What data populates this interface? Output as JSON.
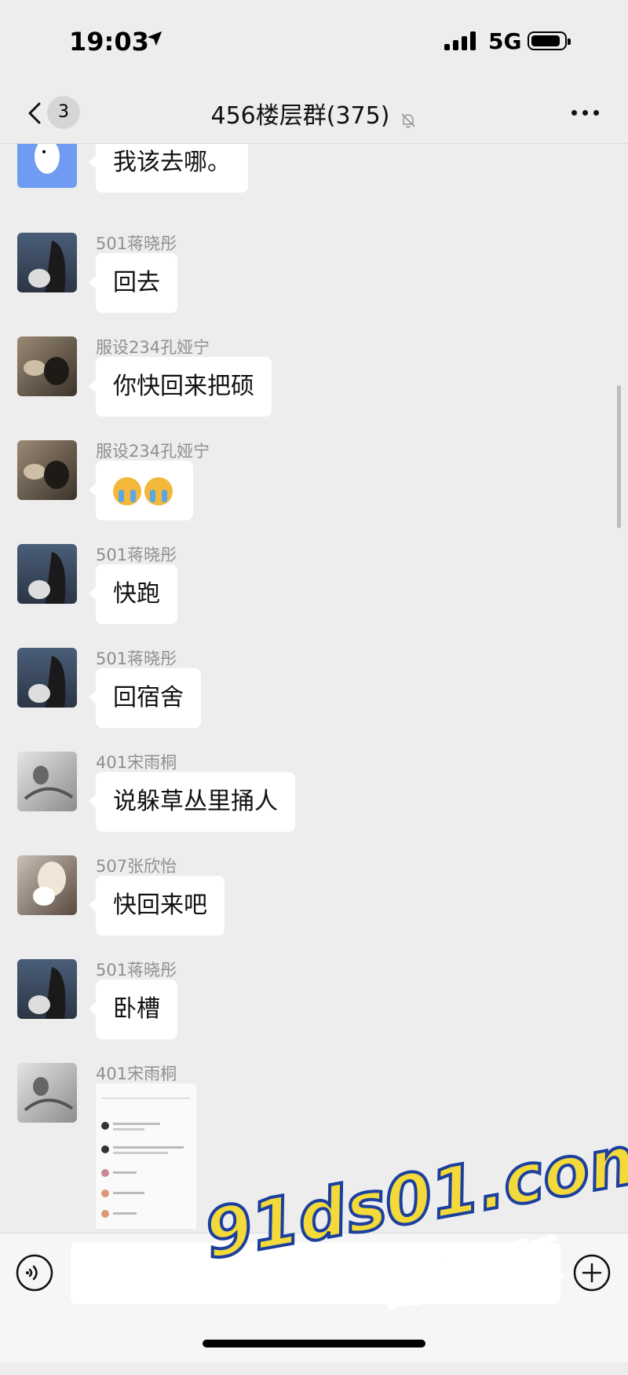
{
  "status_bar": {
    "time": "19:03",
    "network": "5G"
  },
  "header": {
    "back_badge": "3",
    "title": "456楼层群(375)"
  },
  "messages": [
    {
      "sender": "",
      "text": "我该去哪。"
    },
    {
      "sender": "501蒋晓彤",
      "text": "回去"
    },
    {
      "sender": "服设234孔娅宁",
      "text": "你快回来把硕"
    },
    {
      "sender": "服设234孔娅宁",
      "text": ""
    },
    {
      "sender": "501蒋晓彤",
      "text": "快跑"
    },
    {
      "sender": "501蒋晓彤",
      "text": "回宿舍"
    },
    {
      "sender": "401宋雨桐",
      "text": "说躲草丛里捅人"
    },
    {
      "sender": "507张欣怡",
      "text": "快回来吧"
    },
    {
      "sender": "501蒋晓彤",
      "text": "卧槽"
    },
    {
      "sender": "401宋雨桐",
      "text": ""
    }
  ],
  "watermark": {
    "line1": "91ds01.com",
    "line2": "看完整版"
  },
  "colors": {
    "background": "#ededed",
    "bubble": "#ffffff",
    "sender": "#8f8f8f"
  }
}
